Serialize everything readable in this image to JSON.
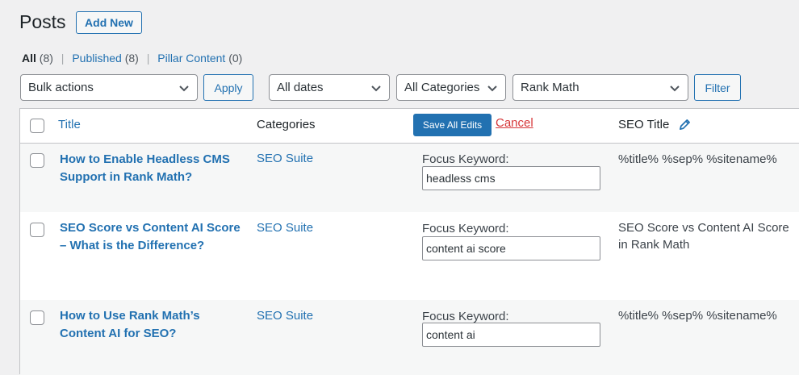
{
  "header": {
    "title": "Posts",
    "add_new_label": "Add New"
  },
  "views": [
    {
      "label": "All",
      "count": "(8)"
    },
    {
      "label": "Published",
      "count": "(8)"
    },
    {
      "label": "Pillar Content",
      "count": "(0)"
    }
  ],
  "filters": {
    "bulk_actions": "Bulk actions",
    "apply_label": "Apply",
    "dates": "All dates",
    "categories": "All Categories",
    "seo_filter": "Rank Math",
    "filter_label": "Filter"
  },
  "table": {
    "columns": {
      "title": "Title",
      "categories": "Categories",
      "save_all": "Save All Edits",
      "cancel": "Cancel",
      "seo_title": "SEO Title"
    },
    "focus_keyword_label": "Focus Keyword:",
    "rows": [
      {
        "title": "How to Enable Headless CMS Support in Rank Math?",
        "category": "SEO Suite",
        "focus_keyword": "headless cms",
        "seo_title": "%title% %sep% %sitename%"
      },
      {
        "title": "SEO Score vs Content AI Score – What is the Difference?",
        "category": "SEO Suite",
        "focus_keyword": "content ai score",
        "seo_title": "SEO Score vs Content AI Score in Rank Math"
      },
      {
        "title": "How to Use Rank Math’s Content AI for SEO?",
        "category": "SEO Suite",
        "focus_keyword": "content ai",
        "seo_title": "%title% %sep% %sitename%"
      }
    ]
  },
  "colors": {
    "accent": "#2271b1",
    "danger": "#d63638",
    "background": "#f0f0f1"
  }
}
